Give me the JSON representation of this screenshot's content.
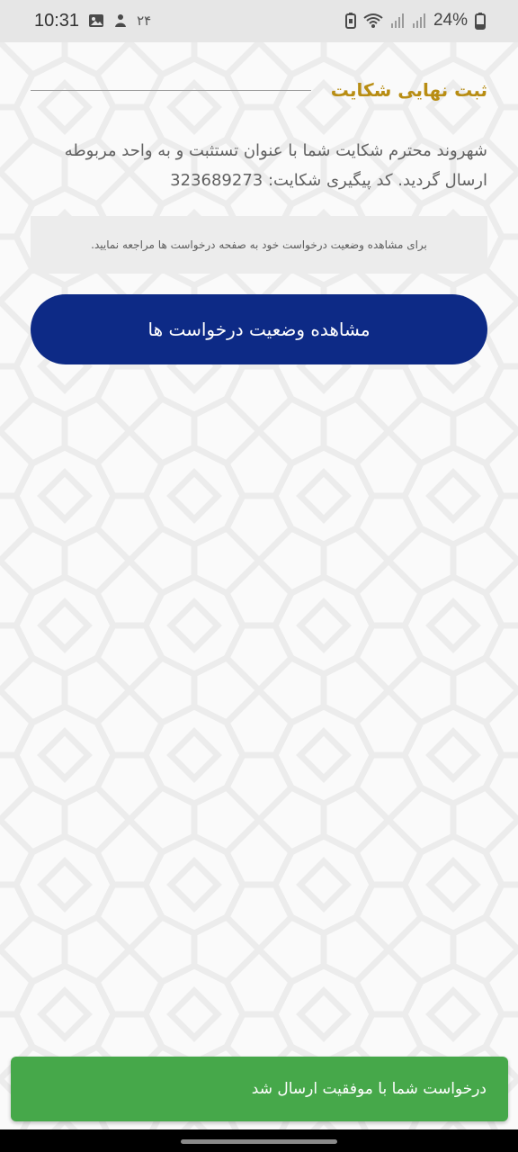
{
  "status_bar": {
    "time": "10:31",
    "extra": "۲۴",
    "battery": "24%",
    "icons": [
      "gallery-icon",
      "notification-icon",
      "battery-saver-icon",
      "wifi-icon",
      "signal-icon",
      "signal-icon-2",
      "battery-icon"
    ]
  },
  "page": {
    "title": "ثبت نهایی شکایت",
    "message": "شهروند محترم شکایت شما با عنوان تستثبت و به واحد مربوطه ارسال گردید. کد پیگیری شکایت: 323689273",
    "info": "برای مشاهده وضعیت درخواست خود به صفحه درخواست ها مراجعه نمایید.",
    "button_label": "مشاهده وضعیت درخواست ها"
  },
  "toast": {
    "text": "درخواست شما با موفقیت ارسال شد"
  },
  "colors": {
    "title": "#b88d13",
    "button": "#0d2a86",
    "toast": "#46a84a"
  }
}
